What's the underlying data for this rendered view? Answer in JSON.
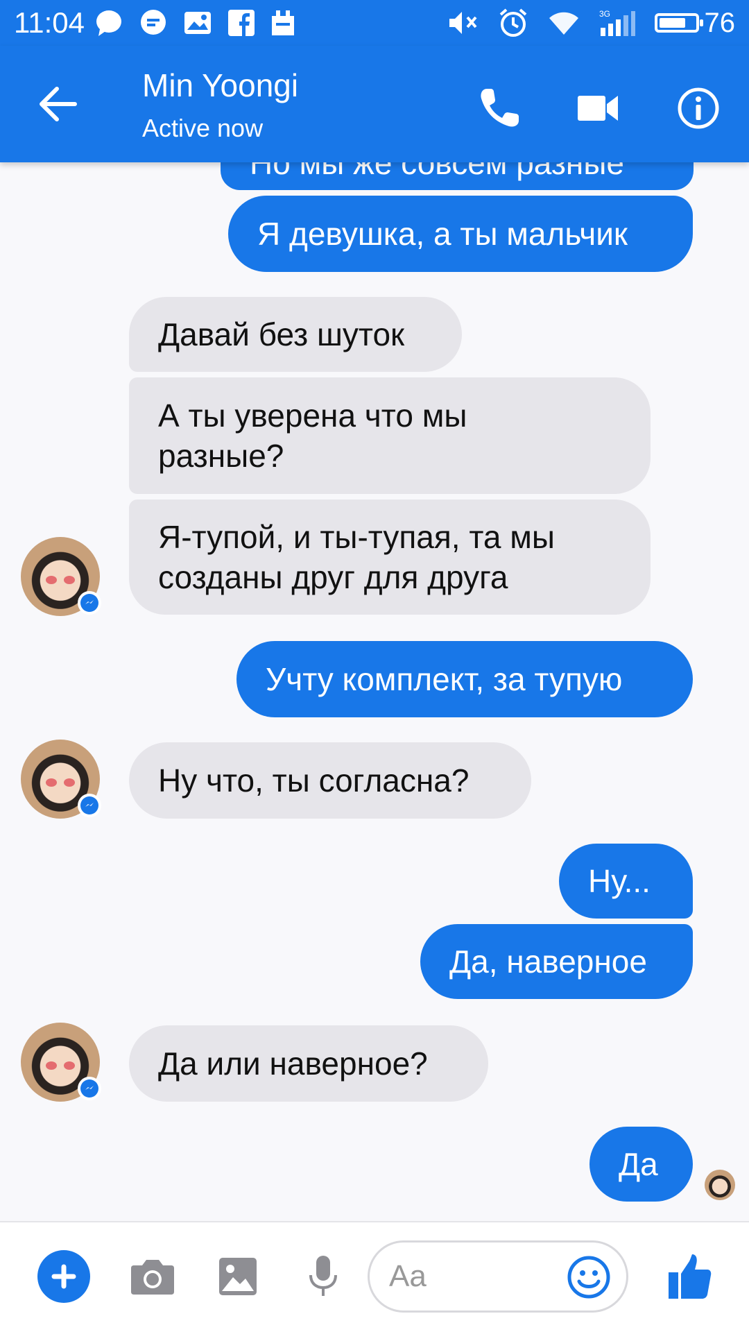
{
  "status_bar": {
    "time": "11:04",
    "battery": "76",
    "battery_level": 0.76,
    "network": "3G"
  },
  "header": {
    "name": "Min Yoongi",
    "status": "Active now",
    "back_icon": "arrow-left-icon",
    "call_icon": "phone-icon",
    "video_icon": "video-camera-icon",
    "info_icon": "info-icon"
  },
  "messages": [
    {
      "from": "me",
      "text": "Но мы же совсем разные"
    },
    {
      "from": "me",
      "text": "Я девушка, а ты мальчик"
    },
    {
      "from": "them",
      "text": "Давай без шуток"
    },
    {
      "from": "them",
      "text": "А ты уверена что мы разные?"
    },
    {
      "from": "them",
      "text": "Я-тупой, и ты-тупая, та мы созданы друг для друга"
    },
    {
      "from": "me",
      "text": "Учту комплект, за тупую"
    },
    {
      "from": "them",
      "text": "Ну что, ты согласна?"
    },
    {
      "from": "me",
      "text": "Ну..."
    },
    {
      "from": "me",
      "text": "Да, наверное"
    },
    {
      "from": "them",
      "text": "Да или наверное?"
    },
    {
      "from": "me",
      "text": "Да"
    }
  ],
  "composer": {
    "placeholder": "Aa",
    "icons": [
      "plus-icon",
      "camera-icon",
      "image-icon",
      "microphone-icon",
      "smiley-icon",
      "thumbs-up-icon"
    ]
  },
  "colors": {
    "accent": "#1877e8",
    "incoming_bubble": "#e6e5ea",
    "background": "#f8f8fb"
  }
}
